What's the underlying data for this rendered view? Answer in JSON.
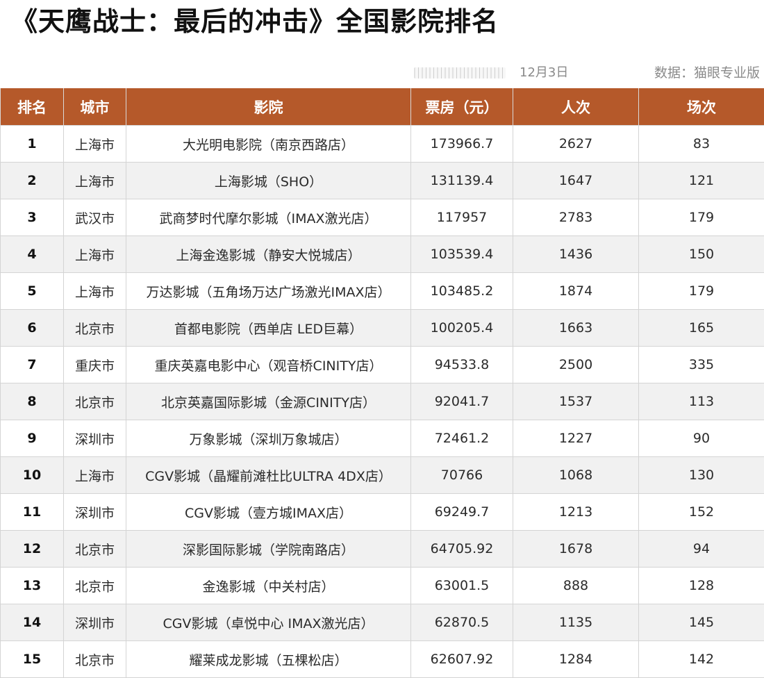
{
  "title": "《天鹰战士：最后的冲击》全国影院排名",
  "date": "12月3日",
  "source": "数据：猫眼专业版",
  "table": {
    "headers": [
      "排名",
      "城市",
      "影院",
      "票房（元）",
      "人次",
      "场次"
    ],
    "rows": [
      [
        "1",
        "上海市",
        "大光明电影院（南京西路店）",
        "173966.7",
        "2627",
        "83"
      ],
      [
        "2",
        "上海市",
        "上海影城（SHO）",
        "131139.4",
        "1647",
        "121"
      ],
      [
        "3",
        "武汉市",
        "武商梦时代摩尔影城（IMAX激光店）",
        "117957",
        "2783",
        "179"
      ],
      [
        "4",
        "上海市",
        "上海金逸影城（静安大悦城店）",
        "103539.4",
        "1436",
        "150"
      ],
      [
        "5",
        "上海市",
        "万达影城（五角场万达广场激光IMAX店）",
        "103485.2",
        "1874",
        "179"
      ],
      [
        "6",
        "北京市",
        "首都电影院（西单店 LED巨幕）",
        "100205.4",
        "1663",
        "165"
      ],
      [
        "7",
        "重庆市",
        "重庆英嘉电影中心（观音桥CINITY店）",
        "94533.8",
        "2500",
        "335"
      ],
      [
        "8",
        "北京市",
        "北京英嘉国际影城（金源CINITY店）",
        "92041.7",
        "1537",
        "113"
      ],
      [
        "9",
        "深圳市",
        "万象影城（深圳万象城店）",
        "72461.2",
        "1227",
        "90"
      ],
      [
        "10",
        "上海市",
        "CGV影城（晶耀前滩杜比ULTRA 4DX店）",
        "70766",
        "1068",
        "130"
      ],
      [
        "11",
        "深圳市",
        "CGV影城（壹方城IMAX店）",
        "69249.7",
        "1213",
        "152"
      ],
      [
        "12",
        "北京市",
        "深影国际影城（学院南路店）",
        "64705.92",
        "1678",
        "94"
      ],
      [
        "13",
        "北京市",
        "金逸影城（中关村店）",
        "63001.5",
        "888",
        "128"
      ],
      [
        "14",
        "深圳市",
        "CGV影城（卓悦中心 IMAX激光店）",
        "62870.5",
        "1135",
        "145"
      ],
      [
        "15",
        "北京市",
        "耀莱成龙影城（五棵松店）",
        "62607.92",
        "1284",
        "142"
      ]
    ]
  },
  "colors": {
    "header_bg": "#b5592a",
    "header_text": "#ffffff",
    "row_alt_bg": "#f1f1f1"
  }
}
